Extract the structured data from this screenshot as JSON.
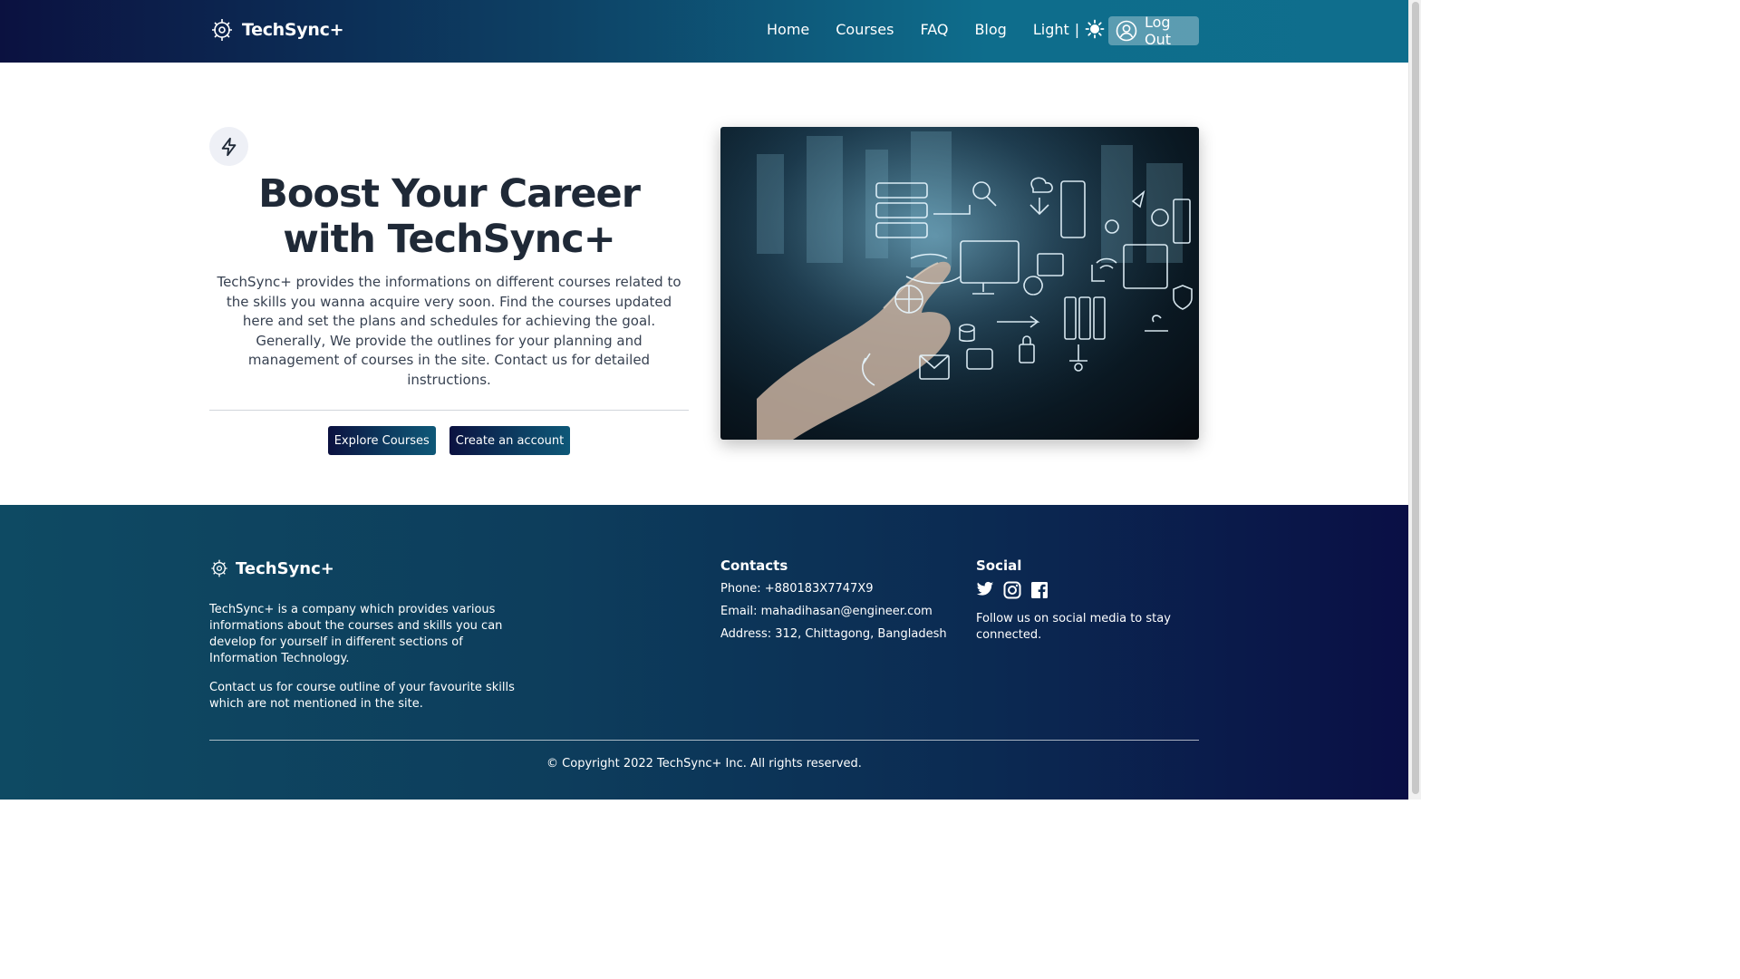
{
  "navbar": {
    "brand": "TechSync+",
    "links": [
      "Home",
      "Courses",
      "FAQ",
      "Blog"
    ],
    "theme_label": "Light",
    "theme_separator": "|",
    "logout_label": "Log Out"
  },
  "hero": {
    "title": "Boost Your Career with TechSync+",
    "description": "TechSync+ provides the informations on different courses related to the skills you wanna acquire very soon. Find the courses updated here and set the plans and schedules for achieving the goal. Generally, We provide the outlines for your planning and management of courses in the site. Contact us for detailed instructions.",
    "buttons": {
      "explore": "Explore Courses",
      "create": "Create an account"
    }
  },
  "footer": {
    "brand": "TechSync+",
    "description_1": "TechSync+ is a company which provides various informations about the courses and skills you can develop for yourself in different sections of Information Technology.",
    "description_2": "Contact us for course outline of your favourite skills which are not mentioned in the site.",
    "contacts": {
      "heading": "Contacts",
      "phone": "Phone: +880183X7747X9",
      "email": "Email: mahadihasan@engineer.com",
      "address": "Address: 312, Chittagong, Bangladesh"
    },
    "social": {
      "heading": "Social",
      "icons": [
        "twitter-icon",
        "instagram-icon",
        "facebook-icon"
      ],
      "text": "Follow us on social media to stay connected."
    },
    "copyright": "© Copyright 2022 TechSync+ Inc. All rights reserved."
  },
  "colors": {
    "nav_gradient_start": "#0b1140",
    "nav_gradient_end": "#0f6e8d",
    "footer_gradient_start": "#0e4a63",
    "footer_gradient_end": "#0a0f45",
    "heading_text": "#1f2937"
  }
}
